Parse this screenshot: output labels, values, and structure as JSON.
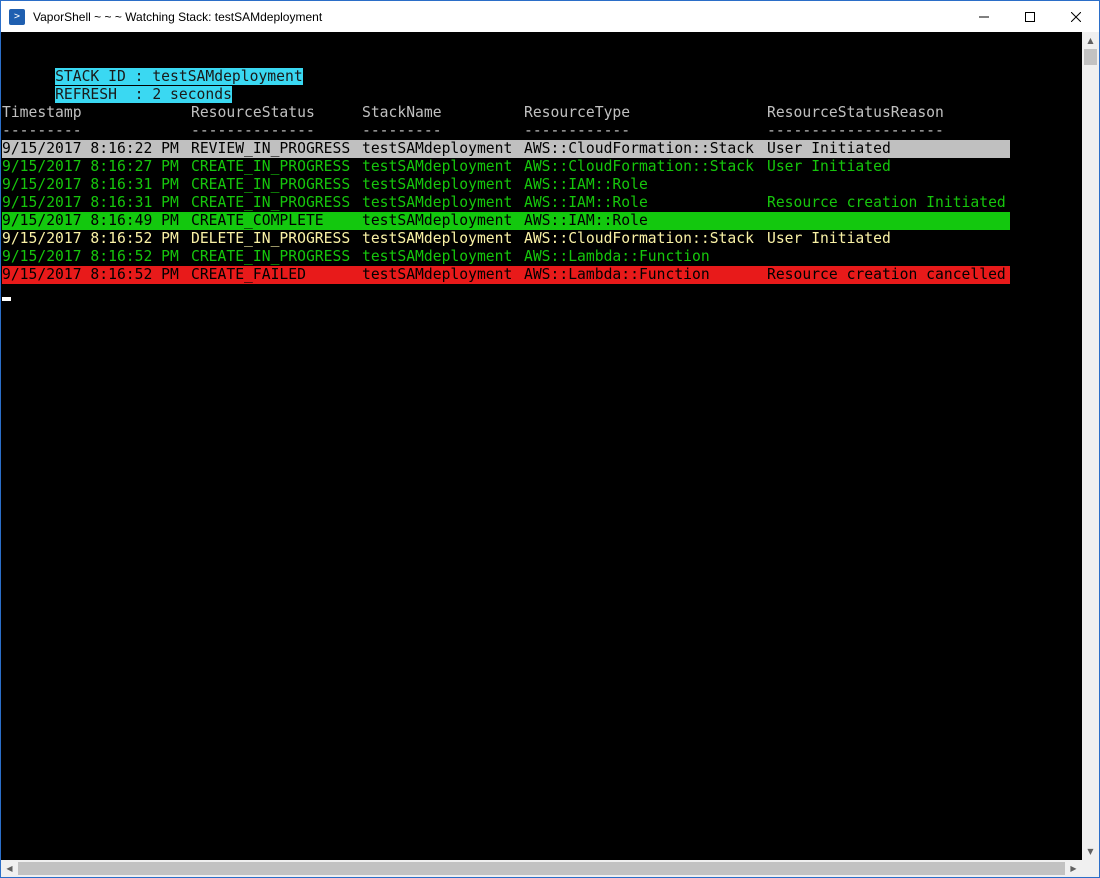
{
  "window": {
    "title": "VaporShell ~ ~ ~ Watching Stack: testSAMdeployment",
    "icon": "powershell-icon",
    "controls": {
      "minimize": "—",
      "maximize": "☐",
      "close": "✕"
    }
  },
  "console": {
    "stack_id_line": "STACK ID : testSAMdeployment",
    "refresh_line": "REFRESH  : 2 seconds",
    "columns": {
      "timestamp": "Timestamp",
      "resource_status": "ResourceStatus",
      "stack_name": "StackName",
      "resource_type": "ResourceType",
      "resource_status_reason": "ResourceStatusReason"
    },
    "separators": {
      "timestamp": "---------",
      "resource_status": "--------------",
      "stack_name": "---------",
      "resource_type": "------------",
      "resource_status_reason": "--------------------"
    },
    "rows": [
      {
        "timestamp": "9/15/2017 8:16:22 PM",
        "status": "REVIEW_IN_PROGRESS",
        "stack": "testSAMdeployment",
        "type": "AWS::CloudFormation::Stack",
        "reason": "User Initiated"
      },
      {
        "timestamp": "9/15/2017 8:16:27 PM",
        "status": "CREATE_IN_PROGRESS",
        "stack": "testSAMdeployment",
        "type": "AWS::CloudFormation::Stack",
        "reason": "User Initiated"
      },
      {
        "timestamp": "9/15/2017 8:16:31 PM",
        "status": "CREATE_IN_PROGRESS",
        "stack": "testSAMdeployment",
        "type": "AWS::IAM::Role",
        "reason": ""
      },
      {
        "timestamp": "9/15/2017 8:16:31 PM",
        "status": "CREATE_IN_PROGRESS",
        "stack": "testSAMdeployment",
        "type": "AWS::IAM::Role",
        "reason": "Resource creation Initiated"
      },
      {
        "timestamp": "9/15/2017 8:16:49 PM",
        "status": "CREATE_COMPLETE",
        "stack": "testSAMdeployment",
        "type": "AWS::IAM::Role",
        "reason": ""
      },
      {
        "timestamp": "9/15/2017 8:16:52 PM",
        "status": "DELETE_IN_PROGRESS",
        "stack": "testSAMdeployment",
        "type": "AWS::CloudFormation::Stack",
        "reason": "User Initiated"
      },
      {
        "timestamp": "9/15/2017 8:16:52 PM",
        "status": "CREATE_IN_PROGRESS",
        "stack": "testSAMdeployment",
        "type": "AWS::Lambda::Function",
        "reason": ""
      },
      {
        "timestamp": "9/15/2017 8:16:52 PM",
        "status": "CREATE_FAILED",
        "stack": "testSAMdeployment",
        "type": "AWS::Lambda::Function",
        "reason": "Resource creation cancelled"
      }
    ]
  },
  "colors": {
    "console_bg": "#000000",
    "header_highlight": "#3ad8f2",
    "review": "#c0c0c0",
    "in_progress": "#16c60c",
    "complete": "#13c80e",
    "delete": "#f9f1a5",
    "failed": "#e81a1a"
  }
}
